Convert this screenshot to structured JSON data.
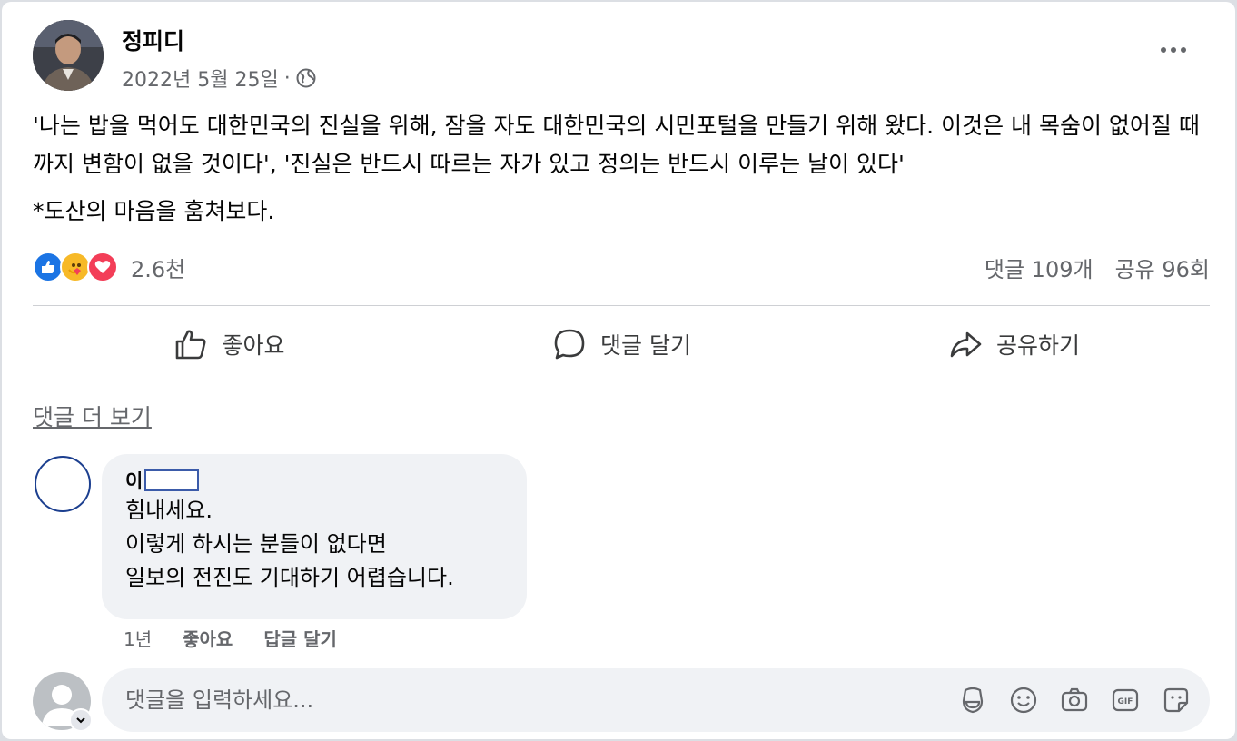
{
  "post": {
    "author_name": "정피디",
    "date": "2022년 5월 25일",
    "separator": "·",
    "paragraphs": [
      "'나는 밥을 먹어도 대한민국의 진실을 위해, 잠을 자도 대한민국의 시민포털을 만들기 위해 왔다. 이것은 내 목숨이 없어질 때까지 변함이 없을 것이다', '진실은 반드시 따르는 자가 있고 정의는 반드시 이루는 날이 있다'",
      "*도산의 마음을 훔쳐보다."
    ]
  },
  "reactions": {
    "types": [
      "like-icon",
      "care-icon",
      "love-icon"
    ],
    "count": "2.6천",
    "comments": "댓글 109개",
    "shares": "공유 96회"
  },
  "actions": {
    "like": "좋아요",
    "comment": "댓글 달기",
    "share": "공유하기"
  },
  "comments_section": {
    "more_label": "댓글 더 보기",
    "items": [
      {
        "author": "이",
        "lines": [
          "힘내세요.",
          "이렇게 하시는 분들이 없다면",
          "일보의 전진도 기대하기 어렵습니다."
        ],
        "time": "1년",
        "like": "좋아요",
        "reply": "답글 달기"
      }
    ]
  },
  "composer": {
    "placeholder": "댓글을 입력하세요..."
  },
  "colors": {
    "accent": "#1b74e4",
    "care": "#f7b928",
    "love": "#f33e58",
    "secondary_text": "#65676b",
    "bubble": "#f0f2f5"
  }
}
